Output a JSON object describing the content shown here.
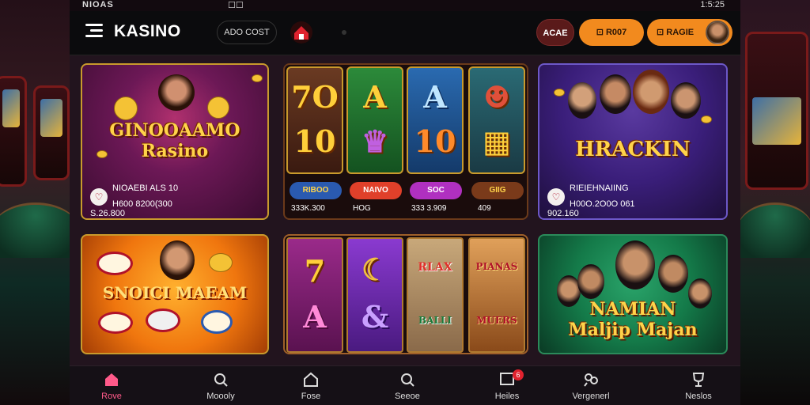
{
  "status": {
    "left": "NIOAS",
    "center": "☐☐",
    "time": "1:5:25"
  },
  "appbar": {
    "brand": "KASINO",
    "account_pill": "ADO COST",
    "wallet_label": "ACAE",
    "deposit_label": "R007",
    "profile_label": "RAGIE"
  },
  "games": [
    {
      "title_line1": "GINOOAAMO",
      "title_line2": "Rasino",
      "meta_line1": "NIOAEBI ALS 10",
      "meta_line2": "H600 8200(300 S.26.800"
    },
    {
      "reels": [
        "7O",
        "A",
        "A",
        "☻"
      ],
      "reels_bottom": [
        "10",
        "♛",
        "10",
        "▦"
      ],
      "chips": [
        "RIBOO",
        "NAIVO",
        "SOC",
        "GIIG"
      ],
      "captions": [
        "333K.300",
        "HOG",
        "333 3.909",
        "409"
      ]
    },
    {
      "title": "HRACKIN",
      "meta_line1": "RIEIEHNAIING",
      "meta_line2": "H00O.2O0O 061 902.160"
    },
    {
      "title": "SNOICI MAEAM"
    },
    {
      "reels": [
        "7",
        "☾",
        "RLAX",
        "PIANAS"
      ],
      "reels_bottom": [
        "A",
        "&",
        "BALLI",
        "MUERS"
      ]
    },
    {
      "title_line1": "NAMIAN",
      "title_line2": "Maljip Majan"
    }
  ],
  "nav": [
    {
      "label": "Rove",
      "icon": "home-icon",
      "active": true
    },
    {
      "label": "Moooly",
      "icon": "search-icon",
      "active": false
    },
    {
      "label": "Fose",
      "icon": "house-outline-icon",
      "active": false
    },
    {
      "label": "Seeoe",
      "icon": "search-icon",
      "active": false
    },
    {
      "label": "Heiles",
      "icon": "message-icon",
      "badge": "6",
      "active": false
    },
    {
      "label": "Vergenerl",
      "icon": "gift-icon",
      "active": false
    },
    {
      "label": "Neslos",
      "icon": "trophy-icon",
      "active": false
    }
  ],
  "colors": {
    "accent": "#f28a1e",
    "active_nav": "#ff5a8a",
    "gold_title": "#ffd34a"
  }
}
